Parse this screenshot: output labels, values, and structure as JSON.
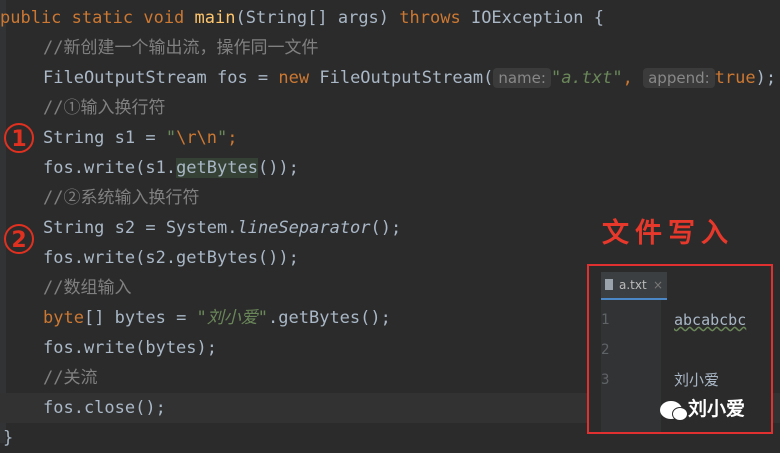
{
  "code": {
    "l1_kw_public": "public",
    "l1_kw_static": "static",
    "l1_kw_void": "void",
    "l1_fn_main": "main",
    "l1_params": "(String[] args)",
    "l1_kw_throws": "throws",
    "l1_exc": "IOException {",
    "l2_comment": "//新创建一个输出流，操作同一文件",
    "l3_a": "FileOutputStream fos = ",
    "l3_kw_new": "new",
    "l3_b": " FileOutputStream(",
    "l3_hint_name": "name:",
    "l3_str": "\"a.txt\"",
    "l3_comma": ",",
    "l3_hint_append": "append:",
    "l3_kw_true": "true",
    "l3_end": ");",
    "l4_comment": "//①输入换行符",
    "l5_a": "String s1 = ",
    "l5_q1": "\"",
    "l5_esc": "\\r\\n",
    "l5_q2": "\"",
    "l5_end": ";",
    "l6_a": "fos.write(s1.",
    "l6_hl": "getBytes",
    "l6_end": "());",
    "l7_comment": "//②系统输入换行符",
    "l8_a": "String s2 = System.",
    "l8_it": "lineSeparator",
    "l8_end": "();",
    "l9": "fos.write(s2.getBytes());",
    "l10_comment": "//数组输入",
    "l11_kw": "byte",
    "l11_a": "[] bytes = ",
    "l11_str": "\"刘小爱\"",
    "l11_end": ".getBytes();",
    "l12": "fos.write(bytes);",
    "l13_comment": "//关流",
    "l14": "fos.close();",
    "l15": "}"
  },
  "markers": {
    "m1": "1",
    "m2": "2"
  },
  "annotation_title": "文件写入",
  "file_preview": {
    "tab_name": "a.txt",
    "tab_close": "×",
    "lines": [
      {
        "num": "1",
        "text": "abcabcbc"
      },
      {
        "num": "2",
        "text": ""
      },
      {
        "num": "3",
        "text": "刘小爱"
      }
    ]
  },
  "watermark": "刘小爱",
  "colors": {
    "background": "#2b2b2b",
    "keyword": "#cc7832",
    "string": "#6a8759",
    "comment": "#808080",
    "method": "#ffc66d",
    "annotation_red": "#e03020"
  }
}
